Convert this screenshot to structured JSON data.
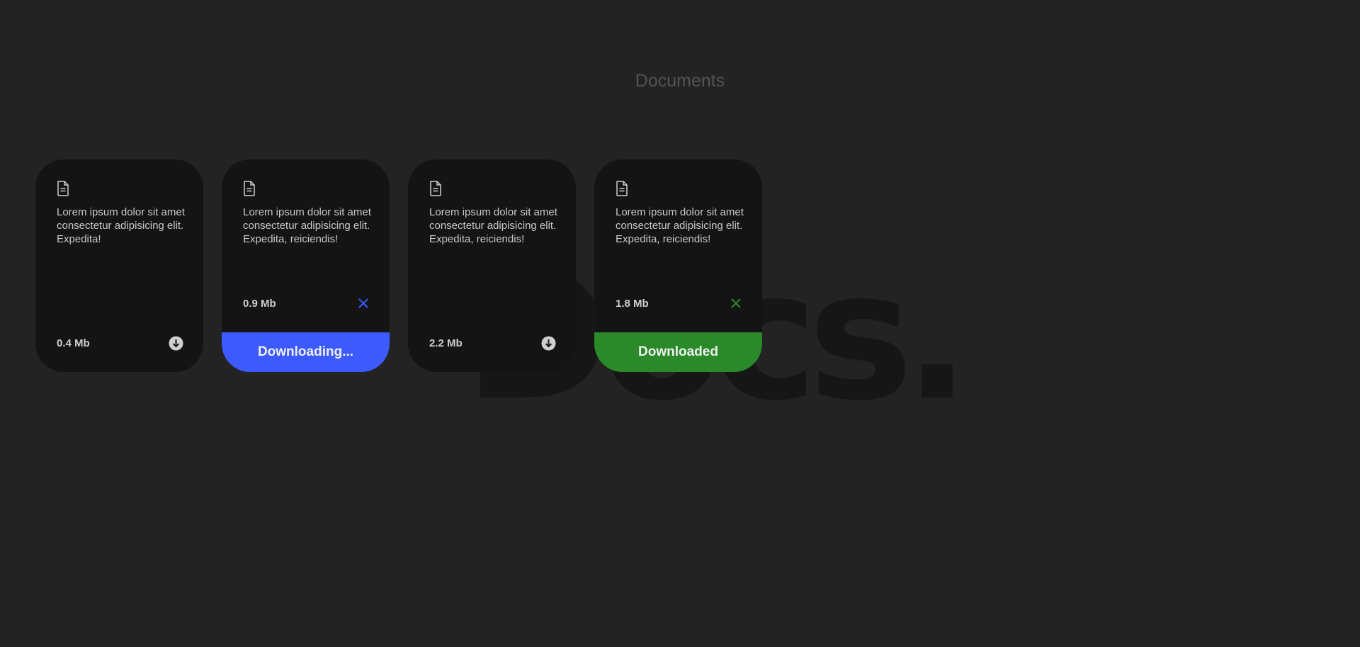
{
  "page": {
    "title": "Documents",
    "backdrop_word": "Docs."
  },
  "colors": {
    "background": "#232323",
    "card": "#141414",
    "downloading_accent": "#3d5afe",
    "downloaded_accent": "#2a8a2a"
  },
  "cards": [
    {
      "text": "Lorem ipsum dolor sit amet consectetur adipisicing elit. Expedita!",
      "size": "0.4 Mb",
      "icon": "download-circle-icon",
      "status": ""
    },
    {
      "text": "Lorem ipsum dolor sit amet consectetur adipisicing elit. Expedita, reiciendis!",
      "size": "0.9 Mb",
      "icon": "close-icon",
      "status": "Downloading..."
    },
    {
      "text": "Lorem ipsum dolor sit amet consectetur adipisicing elit. Expedita, reiciendis!",
      "size": "2.2 Mb",
      "icon": "download-circle-icon",
      "status": ""
    },
    {
      "text": "Lorem ipsum dolor sit amet consectetur adipisicing elit. Expedita, reiciendis!",
      "size": "1.8 Mb",
      "icon": "close-icon",
      "status": "Downloaded"
    }
  ]
}
